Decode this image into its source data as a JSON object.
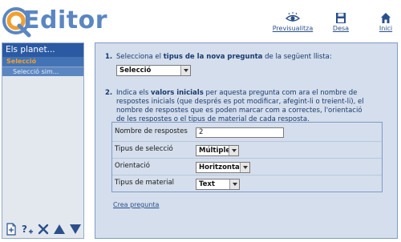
{
  "app": {
    "logo_text": "Editor"
  },
  "header": {
    "links": {
      "preview_label": "Previsualitza",
      "save_label": "Desa",
      "home_label": "Inici"
    }
  },
  "sidebar": {
    "title": "Els planet...",
    "items": [
      {
        "label": "Selecció",
        "selected": true
      },
      {
        "label": "Selecció sim...",
        "selected": false
      }
    ]
  },
  "main": {
    "step1": {
      "number": "1.",
      "text_before": "Selecciona el ",
      "text_bold": "tipus de la nova pregunta",
      "text_after": " de la següent llista:",
      "select_value": "Selecció"
    },
    "step2": {
      "number": "2.",
      "text_before": "Indica els ",
      "text_bold": "valors inicials",
      "text_after": " per aquesta pregunta com ara el nombre de respostes inicials (que després es pot modificar, afegint-li o treient-li), el nombre de respostes que es poden marcar com a correctes, l'orientació de les respostes o el tipus de material de cada resposta."
    },
    "properties": [
      {
        "label": "Nombre de respostes",
        "value": "2"
      },
      {
        "label": "Tipus de selecció",
        "value": "Múltiple"
      },
      {
        "label": "Orientació",
        "value": "Horitzontal"
      },
      {
        "label": "Tipus de material",
        "value": "Text"
      }
    ],
    "create_link": "Crea pregunta"
  },
  "colors": {
    "brand_blue": "#5b86c1",
    "sidebar_header": "#2b5aa3",
    "selected_item_text": "#f0a030",
    "panel_background": "#d4deec"
  },
  "icons": [
    "q-logo-icon",
    "eye-icon",
    "floppy-disk-icon",
    "home-icon",
    "new-page-icon",
    "add-question-icon",
    "delete-icon",
    "move-up-icon",
    "move-down-icon"
  ]
}
